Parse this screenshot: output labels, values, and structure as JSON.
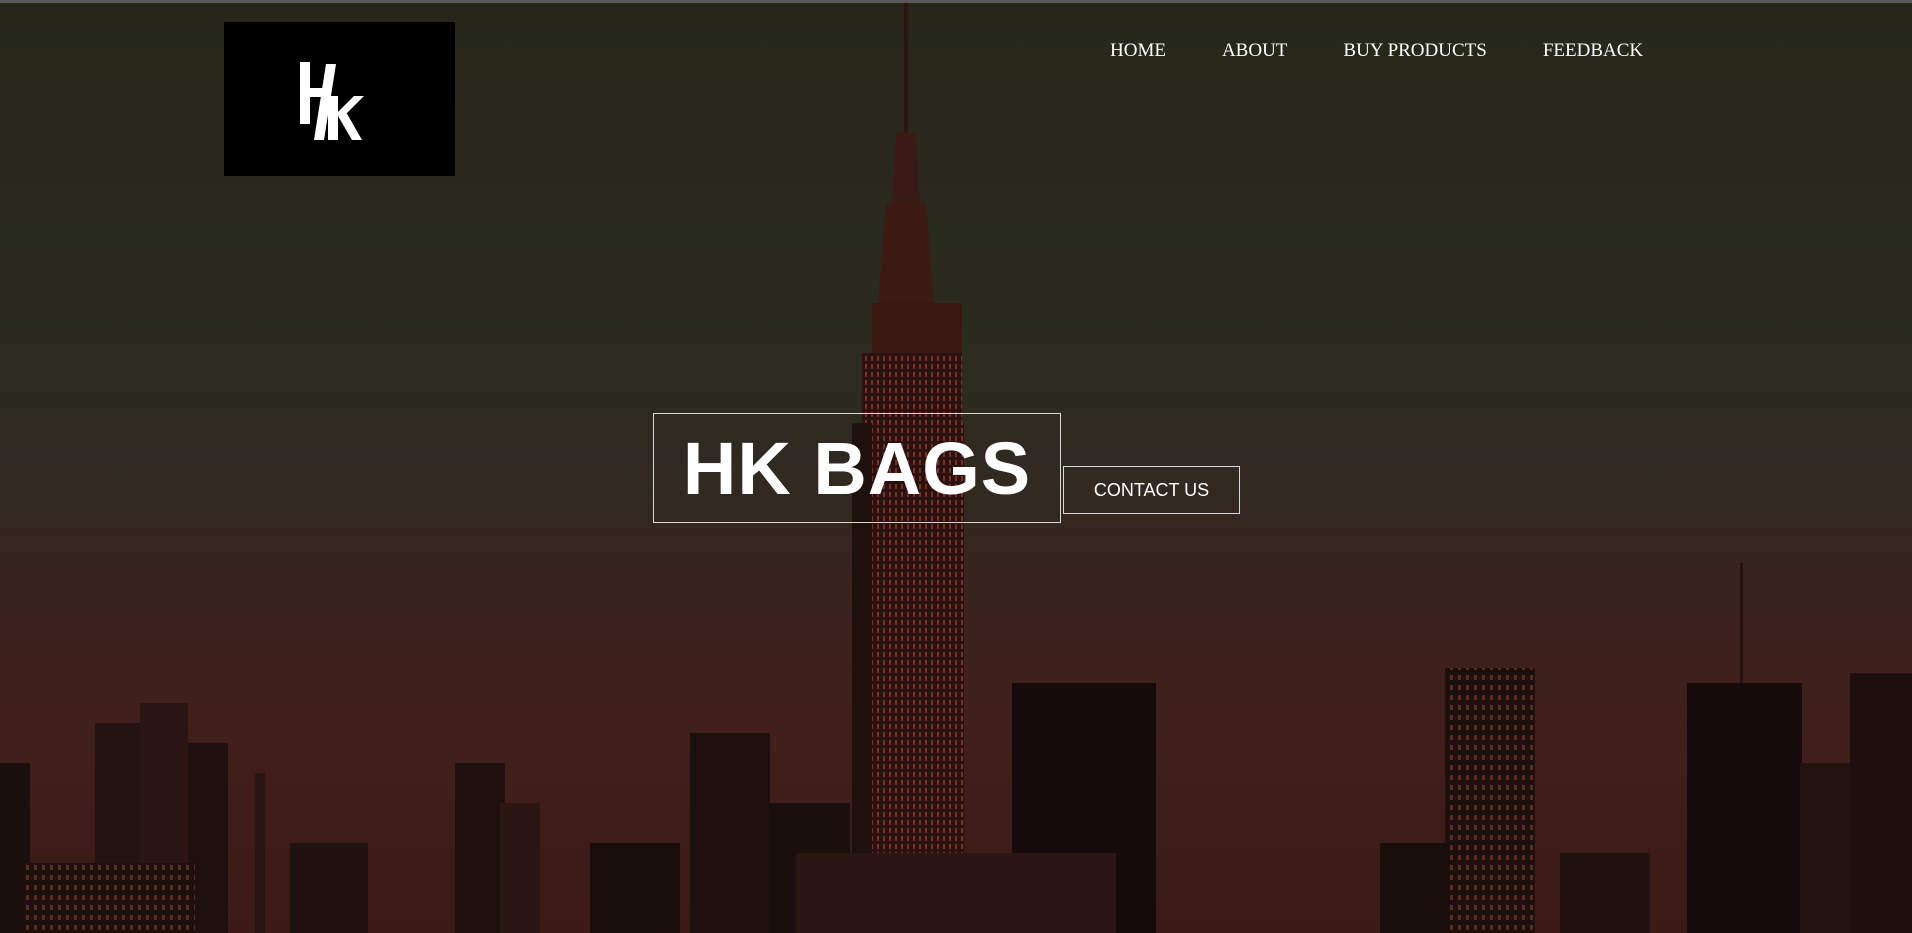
{
  "brand": {
    "logo_text": "HK",
    "logo_icon": "hk-monogram-icon"
  },
  "nav": {
    "items": [
      {
        "label": "HOME"
      },
      {
        "label": "ABOUT"
      },
      {
        "label": "BUY PRODUCTS"
      },
      {
        "label": "FEEDBACK"
      }
    ]
  },
  "hero": {
    "title": "HK BAGS",
    "cta_label": "CONTACT US",
    "background": "city-skyline-sunset-image"
  },
  "colors": {
    "nav_text": "#ffffff",
    "logo_bg": "#000000",
    "hero_border": "#d8d8d8"
  }
}
